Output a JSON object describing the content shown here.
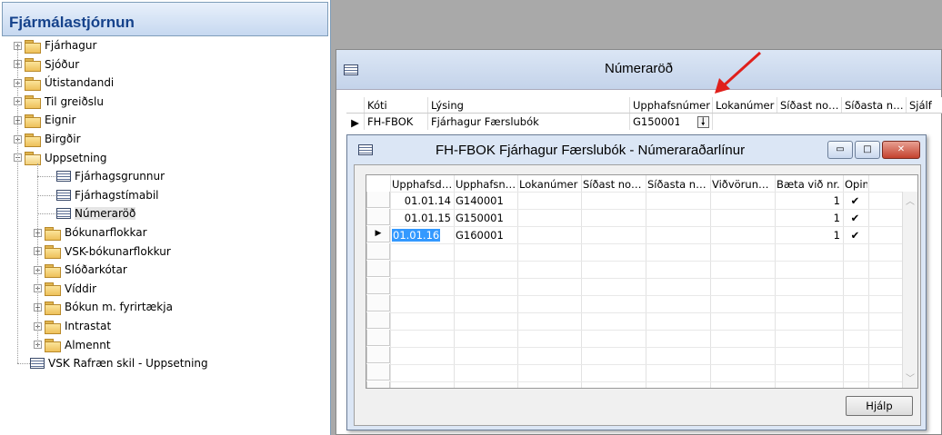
{
  "nav": {
    "title": "Fjármálastjórnun",
    "items": [
      {
        "label": "Fjárhagur",
        "type": "folder",
        "level": 0
      },
      {
        "label": "Sjóður",
        "type": "folder",
        "level": 0
      },
      {
        "label": "Útistandandi",
        "type": "folder",
        "level": 0
      },
      {
        "label": "Til greiðslu",
        "type": "folder",
        "level": 0
      },
      {
        "label": "Eignir",
        "type": "folder",
        "level": 0
      },
      {
        "label": "Birgðir",
        "type": "folder",
        "level": 0
      },
      {
        "label": "Uppsetning",
        "type": "folder-open",
        "level": 0
      },
      {
        "label": "Fjárhagsgrunnur",
        "type": "form",
        "level": 1
      },
      {
        "label": "Fjárhagstímabil",
        "type": "form",
        "level": 1
      },
      {
        "label": "Númeraröð",
        "type": "form",
        "level": 1,
        "selected": true
      },
      {
        "label": "Bókunarflokkar",
        "type": "folder",
        "level": 1
      },
      {
        "label": "VSK-bókunarflokkur",
        "type": "folder",
        "level": 1
      },
      {
        "label": "Slóðarkótar",
        "type": "folder",
        "level": 1
      },
      {
        "label": "Víddir",
        "type": "folder",
        "level": 1
      },
      {
        "label": "Bókun m. fyrirtækja",
        "type": "folder",
        "level": 1
      },
      {
        "label": "Intrastat",
        "type": "folder",
        "level": 1
      },
      {
        "label": "Almennt",
        "type": "folder",
        "level": 1
      },
      {
        "label": "VSK Rafræn skil - Uppsetning",
        "type": "form",
        "level": 0
      }
    ]
  },
  "number_series_window": {
    "title": "Númeraröð",
    "columns": [
      "Kóti",
      "Lýsing",
      "Upphafsnúmer",
      "Lokanúmer",
      "Síðast no…",
      "Síðasta n…",
      "Sjálf"
    ],
    "row": {
      "code": "FH-FBOK",
      "description": "Fjárhagur Færslubók",
      "start_no": "G150001",
      "dropdown_icon": "down-arrow-icon"
    }
  },
  "lines_window": {
    "title": "FH-FBOK Fjárhagur Færslubók - Númeraraðarlínur",
    "columns": [
      "Upphafsd…",
      "Upphafsn…",
      "Lokanúmer",
      "Síðast no…",
      "Síðasta n…",
      "Viðvörun…",
      "Bæta við nr.",
      "Opin"
    ],
    "rows": [
      {
        "start_date": "01.01.14",
        "start_no": "G140001",
        "increment": "1",
        "open": "✔"
      },
      {
        "start_date": "01.01.15",
        "start_no": "G150001",
        "increment": "1",
        "open": "✔"
      },
      {
        "start_date": "01.01.16",
        "start_no": "G160001",
        "increment": "1",
        "open": "✔"
      }
    ],
    "help_button": "Hjálp",
    "buttons": {
      "minimize": "▭",
      "maximize": "□",
      "close": "✕"
    }
  },
  "colors": {
    "annotation_arrow": "#e0201c",
    "selection": "#3399ff",
    "title_text": "#15428b"
  }
}
